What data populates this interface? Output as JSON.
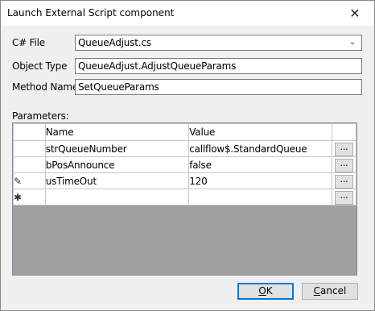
{
  "window": {
    "title": "Launch External Script component",
    "close_glyph": "✕"
  },
  "form": {
    "csfile_label": "C# File",
    "csfile_value": "QueueAdjust.cs",
    "objtype_label": "Object Type",
    "objtype_value": "QueueAdjust.AdjustQueueParams",
    "method_label": "Method Name",
    "method_value": "SetQueueParams",
    "parameters_label": "Parameters:"
  },
  "grid": {
    "columns": [
      "Name",
      "Value"
    ],
    "rows": [
      {
        "marker": "",
        "name": "strQueueNumber",
        "value": "callflow$.StandardQueue",
        "button": "..."
      },
      {
        "marker": "",
        "name": "bPosAnnounce",
        "value": "false",
        "button": "..."
      },
      {
        "marker": "✎",
        "name": "usTimeOut",
        "value": "120",
        "button": "..."
      },
      {
        "marker": "✱",
        "name": "",
        "value": "",
        "button": "..."
      }
    ]
  },
  "buttons": {
    "ok_mnemonic": "O",
    "ok_rest": "K",
    "cancel_mnemonic": "C",
    "cancel_rest": "ancel"
  }
}
